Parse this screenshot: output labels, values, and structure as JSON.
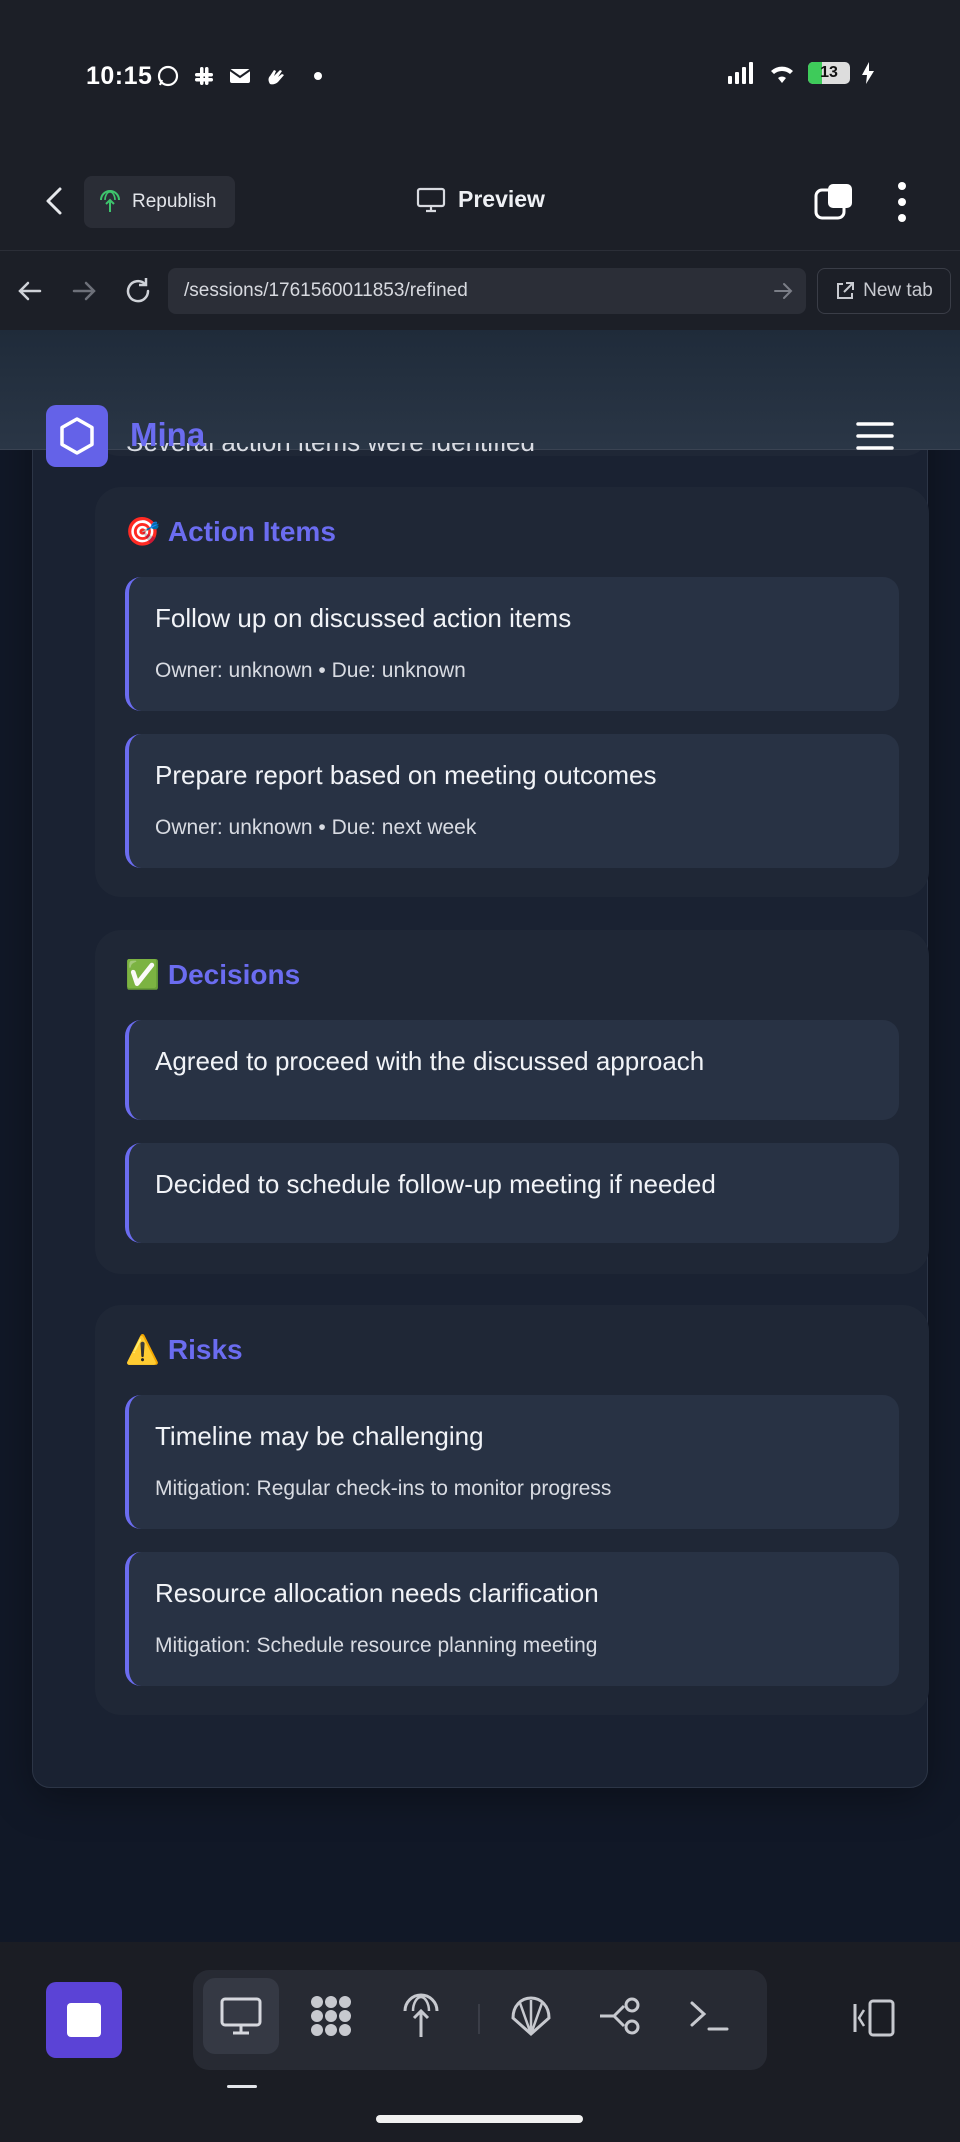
{
  "status_bar": {
    "time": "10:15",
    "battery": "13"
  },
  "app_header": {
    "republish_label": "Republish",
    "preview_label": "Preview"
  },
  "browser": {
    "url": "/sessions/1761560011853/refined",
    "new_tab_label": "New tab"
  },
  "site": {
    "brand": "Mina",
    "partially_hidden_text": "Several action items were identified"
  },
  "sections": {
    "action_items": {
      "emoji": "🎯",
      "title": "Action Items",
      "items": [
        {
          "title": "Follow up on discussed action items",
          "meta": "Owner: unknown • Due: unknown"
        },
        {
          "title": "Prepare report based on meeting outcomes",
          "meta": "Owner: unknown • Due: next week"
        }
      ]
    },
    "decisions": {
      "emoji": "✅",
      "title": "Decisions",
      "items": [
        {
          "title": "Agreed to proceed with the discussed approach"
        },
        {
          "title": "Decided to schedule follow-up meeting if needed"
        }
      ]
    },
    "risks": {
      "emoji": "⚠️",
      "title": "Risks",
      "items": [
        {
          "title": "Timeline may be challenging",
          "meta": "Mitigation: Regular check-ins to monitor progress"
        },
        {
          "title": "Resource allocation needs clarification",
          "meta": "Mitigation: Schedule resource planning meeting"
        }
      ]
    }
  },
  "colors": {
    "accent": "#6b6cf0",
    "stop_button": "#5b43d6",
    "page_bg": "#111827"
  },
  "toolbar": {
    "icons": [
      "monitor-icon",
      "apps-grid-icon",
      "deploy-icon",
      "shell-icon",
      "flow-icon",
      "terminal-icon"
    ]
  }
}
